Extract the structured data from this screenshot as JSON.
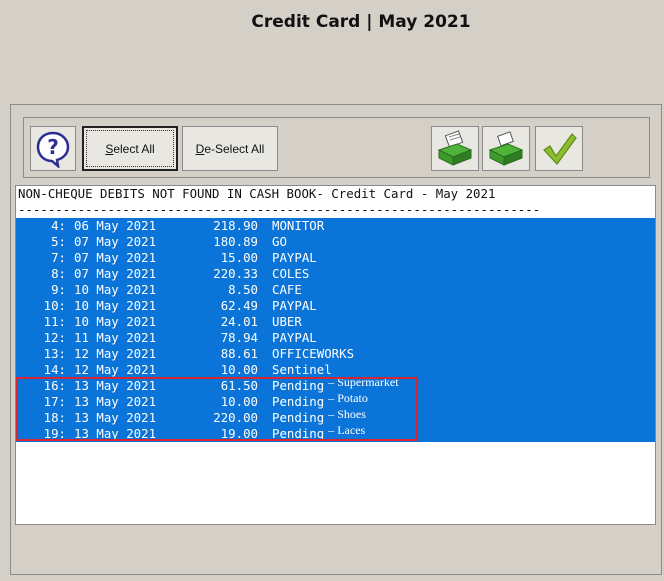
{
  "window": {
    "title": "Credit Card | May 2021"
  },
  "toolbar": {
    "help_icon": "question-mark-icon",
    "select_all": {
      "accel": "S",
      "rest": "elect All"
    },
    "deselect_all": {
      "accel": "D",
      "rest": "e-Select All"
    },
    "print_icon_1": "printer-icon",
    "print_icon_2": "printer-icon",
    "ok_icon": "checkmark-icon",
    "colors": {
      "printer_green": "#3f9a2d",
      "check_green": "#8bbd2e"
    }
  },
  "report": {
    "header": "NON-CHEQUE DEBITS NOT FOUND IN CASH BOOK- Credit Card - May 2021",
    "separator": "----------------------------------------------------------------------",
    "highlight_color": "#0a74d9",
    "rows": [
      {
        "idx": "4:",
        "date": "06 May 2021",
        "amount": "218.90",
        "desc": "MONITOR",
        "note": ""
      },
      {
        "idx": "5:",
        "date": "07 May 2021",
        "amount": "180.89",
        "desc": "GO",
        "note": ""
      },
      {
        "idx": "7:",
        "date": "07 May 2021",
        "amount": "15.00",
        "desc": "PAYPAL",
        "note": ""
      },
      {
        "idx": "8:",
        "date": "07 May 2021",
        "amount": "220.33",
        "desc": "COLES",
        "note": ""
      },
      {
        "idx": "9:",
        "date": "10 May 2021",
        "amount": "8.50",
        "desc": "CAFE",
        "note": ""
      },
      {
        "idx": "10:",
        "date": "10 May 2021",
        "amount": "62.49",
        "desc": "PAYPAL",
        "note": ""
      },
      {
        "idx": "11:",
        "date": "10 May 2021",
        "amount": "24.01",
        "desc": "UBER",
        "note": ""
      },
      {
        "idx": "12:",
        "date": "11 May 2021",
        "amount": "78.94",
        "desc": "PAYPAL",
        "note": ""
      },
      {
        "idx": "13:",
        "date": "12 May 2021",
        "amount": "88.61",
        "desc": "OFFICEWORKS",
        "note": ""
      },
      {
        "idx": "14:",
        "date": "12 May 2021",
        "amount": "10.00",
        "desc": "Sentinel",
        "note": ""
      },
      {
        "idx": "16:",
        "date": "13 May 2021",
        "amount": "61.50",
        "desc": "Pending",
        "note": "– Supermarket"
      },
      {
        "idx": "17:",
        "date": "13 May 2021",
        "amount": "10.00",
        "desc": "Pending",
        "note": "– Potato"
      },
      {
        "idx": "18:",
        "date": "13 May 2021",
        "amount": "220.00",
        "desc": "Pending",
        "note": "– Shoes"
      },
      {
        "idx": "19:",
        "date": "13 May 2021",
        "amount": "19.00",
        "desc": "Pending",
        "note": "– Laces"
      }
    ],
    "annotation_color": "#d9252f"
  }
}
